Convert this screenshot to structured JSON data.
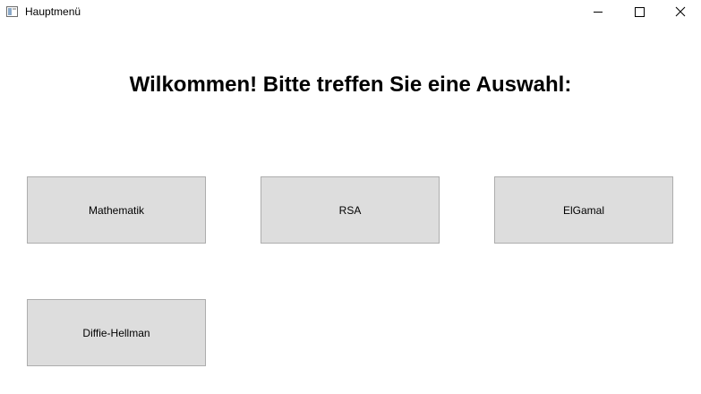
{
  "window": {
    "title": "Hauptmenü",
    "app_icon": "window-app-icon",
    "controls": {
      "minimize_icon": "minimize-icon",
      "maximize_icon": "maximize-icon",
      "close_icon": "close-icon"
    }
  },
  "main": {
    "heading": "Wilkommen! Bitte treffen Sie eine Auswahl:",
    "buttons": [
      {
        "label": "Mathematik"
      },
      {
        "label": "RSA"
      },
      {
        "label": "ElGamal"
      },
      {
        "label": "Diffie-Hellman"
      }
    ]
  },
  "colors": {
    "button_background": "#dddddd",
    "button_border": "#adadad",
    "window_background": "#ffffff"
  }
}
